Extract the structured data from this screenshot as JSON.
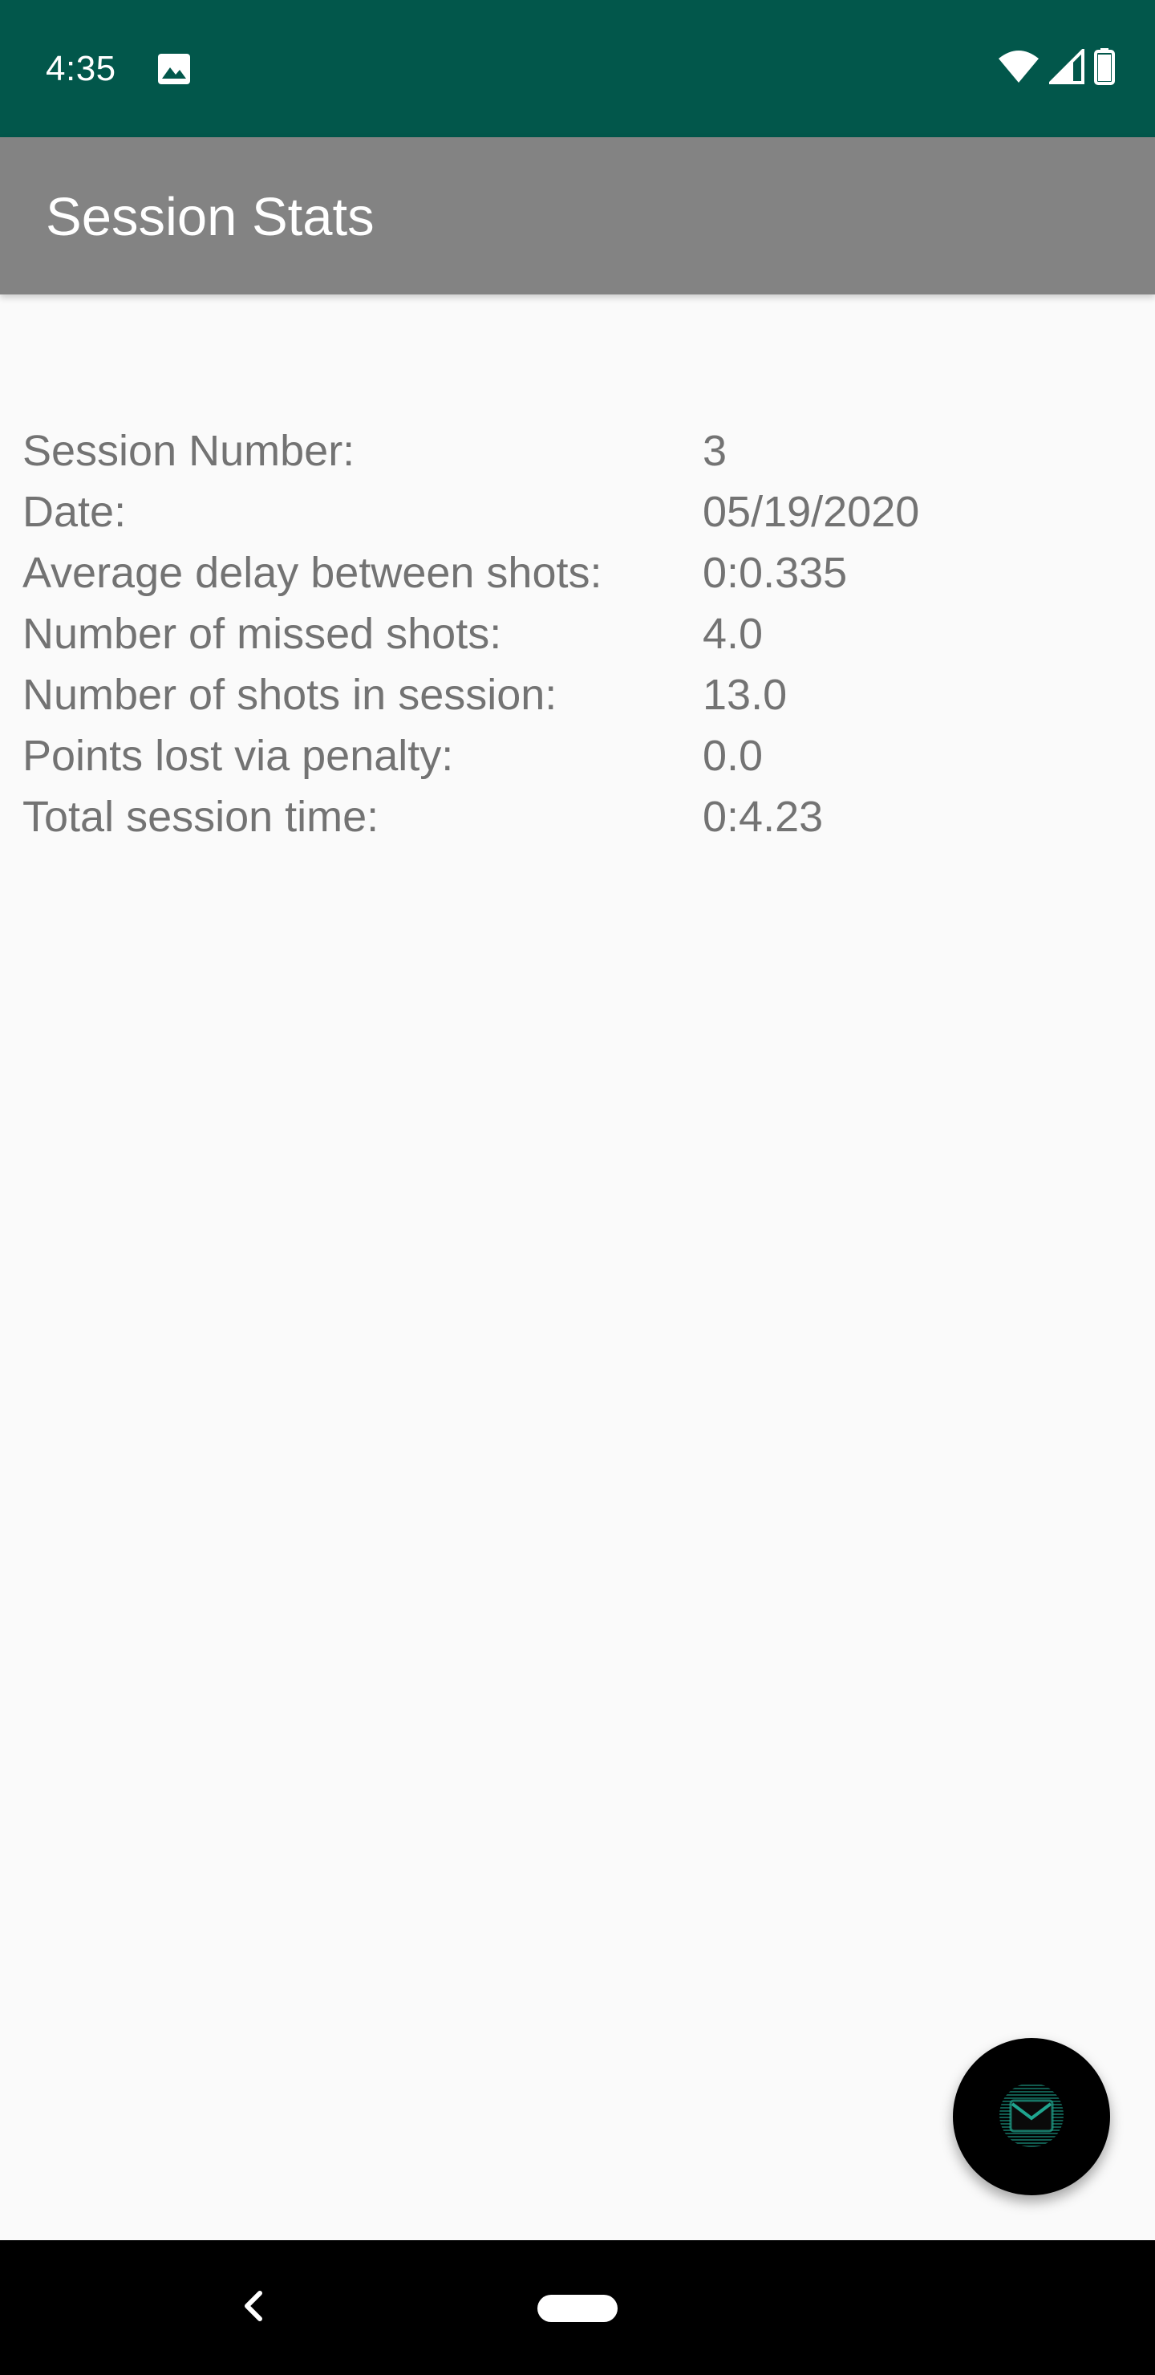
{
  "status_bar": {
    "time": "4:35",
    "icons": [
      "image-icon",
      "wifi-icon",
      "signal-icon",
      "battery-icon"
    ],
    "background_color": "#02574b"
  },
  "app_bar": {
    "title": "Session Stats",
    "background_color": "#838383"
  },
  "stats": [
    {
      "label": "Session Number:",
      "value": "3"
    },
    {
      "label": "Date:",
      "value": "05/19/2020"
    },
    {
      "label": "Average delay between shots:",
      "value": "0:0.335"
    },
    {
      "label": "Number of missed shots:",
      "value": "4.0"
    },
    {
      "label": "Number of shots in session:",
      "value": "13.0"
    },
    {
      "label": "Points lost via penalty:",
      "value": "0.0"
    },
    {
      "label": "Total session time:",
      "value": "0:4.23"
    }
  ],
  "fab": {
    "icon": "email-icon",
    "accent_color": "#1fa58f"
  },
  "nav_bar": {
    "icons": [
      "back-icon",
      "home-pill"
    ]
  }
}
